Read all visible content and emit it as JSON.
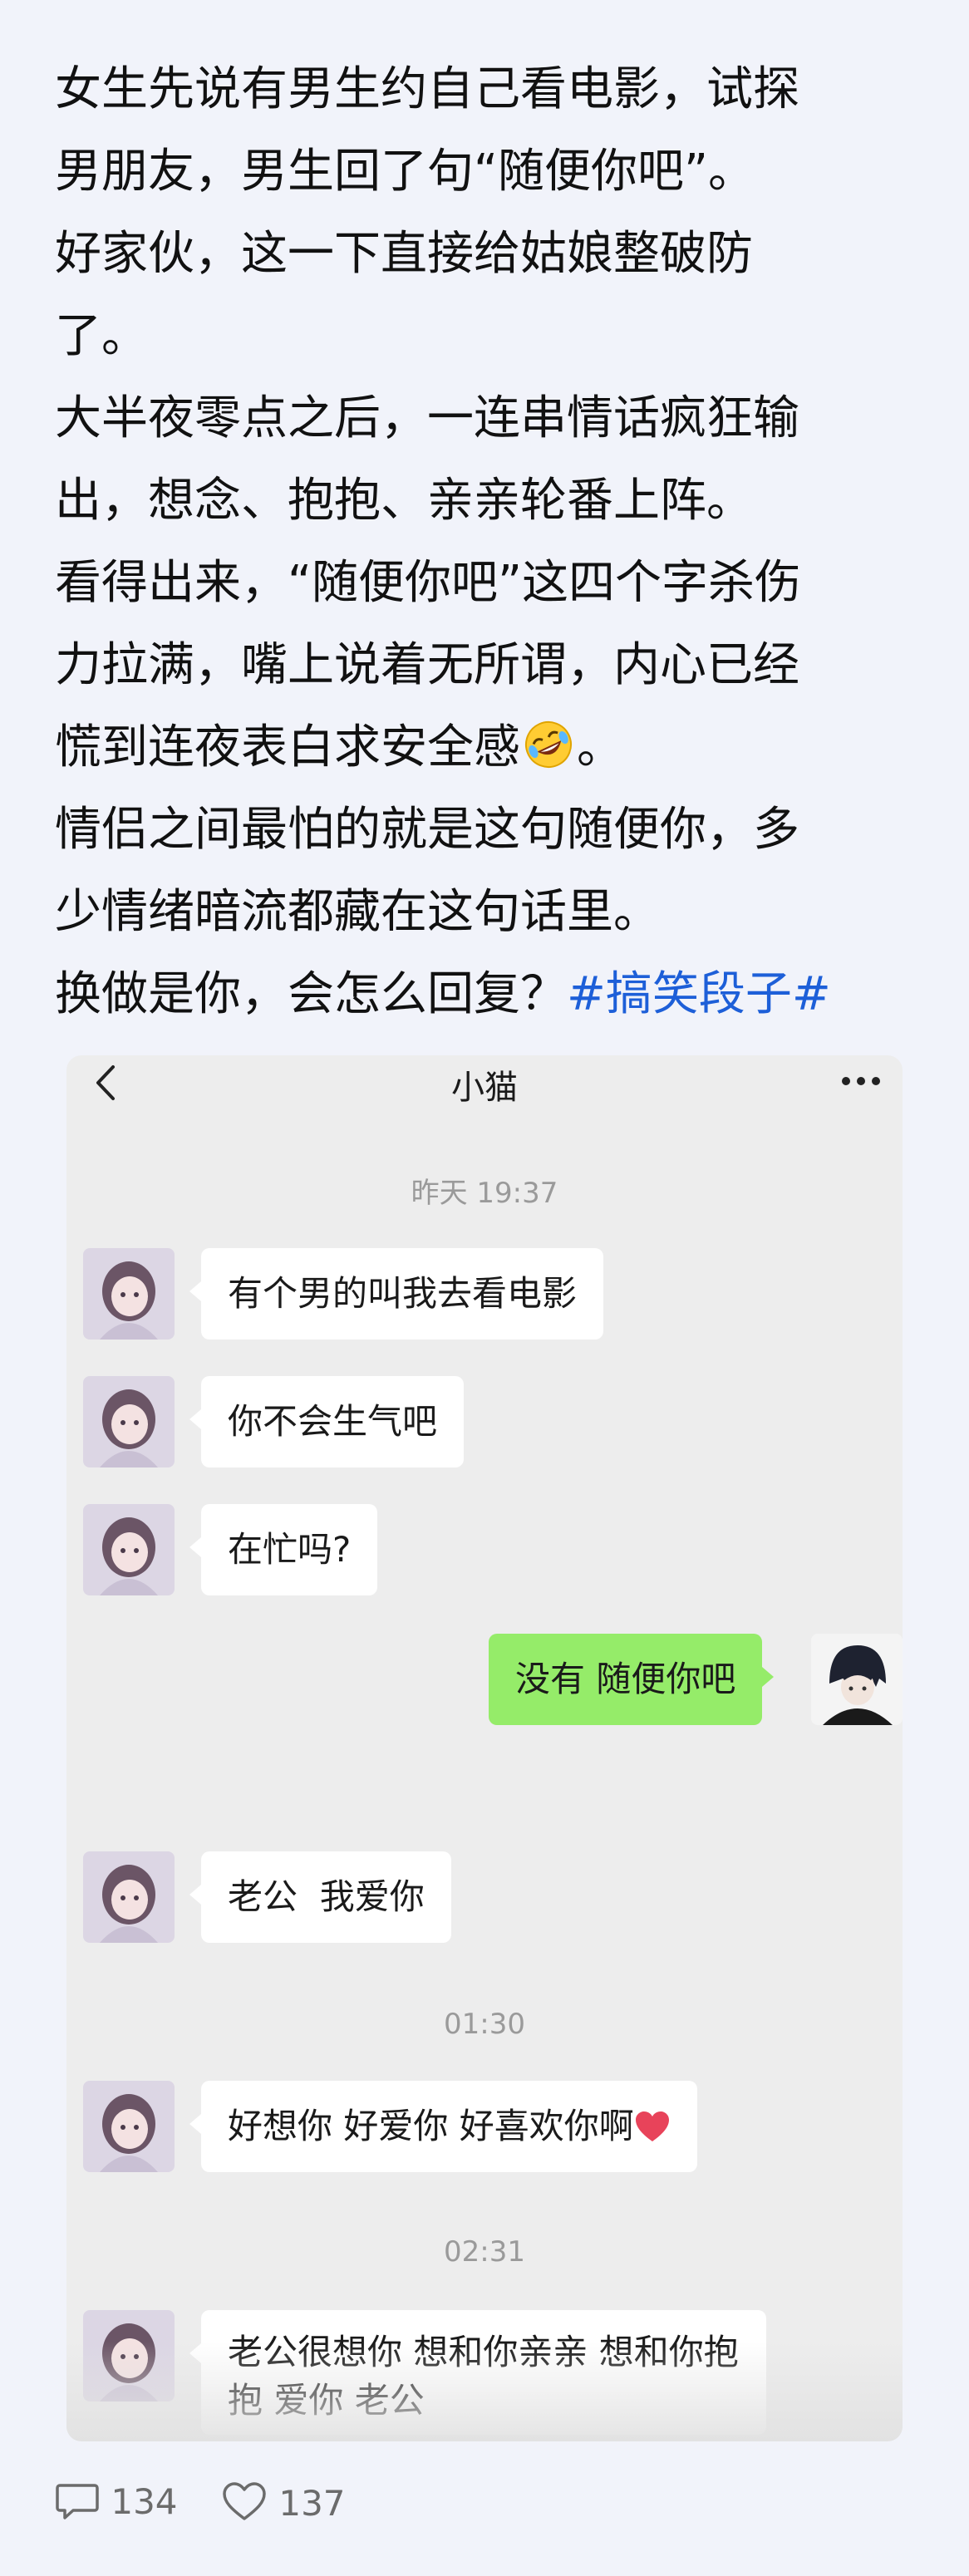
{
  "post": {
    "lines": [
      "女生先说有男生约自己看电影，试探",
      "男朋友，男生回了句“随便你吧”。",
      "好家伙，这一下直接给姑娘整破防",
      "了。",
      "大半夜零点之后，一连串情话疯狂输",
      "出，想念、抱抱、亲亲轮番上阵。",
      "看得出来，“随便你吧”这四个字杀伤",
      "力拉满，嘴上说着无所谓，内心已经",
      "慌到连夜表白求安全感",
      "。",
      "情侣之间最怕的就是这句随便你，多",
      "少情绪暗流都藏在这句话里。",
      "换做是你，会怎么回复？"
    ],
    "hashtag": "#搞笑段子#",
    "emoji": "rolling-on-floor-laughing-icon"
  },
  "chat": {
    "title": "小猫",
    "times": [
      "昨天 19:37",
      "01:30",
      "02:31"
    ],
    "messages": [
      {
        "side": "left",
        "text": "有个男的叫我去看电影"
      },
      {
        "side": "left",
        "text": "你不会生气吧"
      },
      {
        "side": "left",
        "text": "在忙吗?"
      },
      {
        "side": "right",
        "text": "没有 随便你吧"
      },
      {
        "side": "left",
        "text": "老公  我爱你"
      },
      {
        "side": "left",
        "text": "好想你 好爱你 好喜欢你啊"
      },
      {
        "side": "left",
        "text": "老公很想你 想和你亲亲 想和你抱抱 爱你 老公"
      }
    ]
  },
  "stats": {
    "comments": "134",
    "likes": "137"
  },
  "colors": {
    "page_bg": "#f1f3fa",
    "hashtag": "#1d5fd8",
    "bubble_self": "#95ec69",
    "bubble_other": "#ffffff",
    "chat_bg": "#ededed"
  }
}
